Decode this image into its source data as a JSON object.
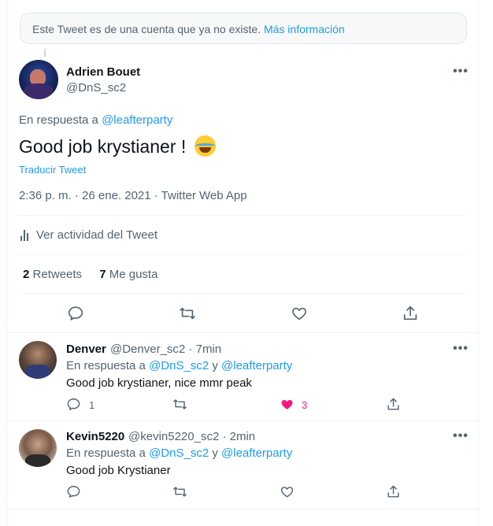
{
  "notice": {
    "text": "Este Tweet es de una cuenta que ya no existe.",
    "link": "Más información"
  },
  "main_tweet": {
    "name": "Adrien Bouet",
    "handle": "@DnS_sc2",
    "reply_prefix": "En respuesta a",
    "reply_to": "@leafterparty",
    "text": "Good job krystianer !",
    "emoji": "face-with-tears-of-joy",
    "translate": "Traducir Tweet",
    "meta": "2:36 p. m. · 26 ene. 2021 · Twitter Web App",
    "activity": "Ver actividad del Tweet",
    "retweets_count": "2",
    "retweets_label": "Retweets",
    "likes_count": "7",
    "likes_label": "Me gusta"
  },
  "replies": [
    {
      "name": "Denver",
      "handle": "@Denver_sc2 · 7min",
      "reply_prefix": "En respuesta a",
      "reply_to_1": "@DnS_sc2",
      "conj": "y",
      "reply_to_2": "@leafterparty",
      "text": "Good job krystianer, nice mmr peak",
      "reply_count": "1",
      "like_count": "3",
      "liked": true
    },
    {
      "name": "Kevin5220",
      "handle": "@kevin5220_sc2 · 2min",
      "reply_prefix": "En respuesta a",
      "reply_to_1": "@DnS_sc2",
      "conj": "y",
      "reply_to_2": "@leafterparty",
      "text": "Good job Krystianer",
      "reply_count": "",
      "like_count": "",
      "liked": false
    }
  ],
  "colors": {
    "accent": "#1d9bf0",
    "muted": "#536471",
    "like": "#f91880"
  }
}
